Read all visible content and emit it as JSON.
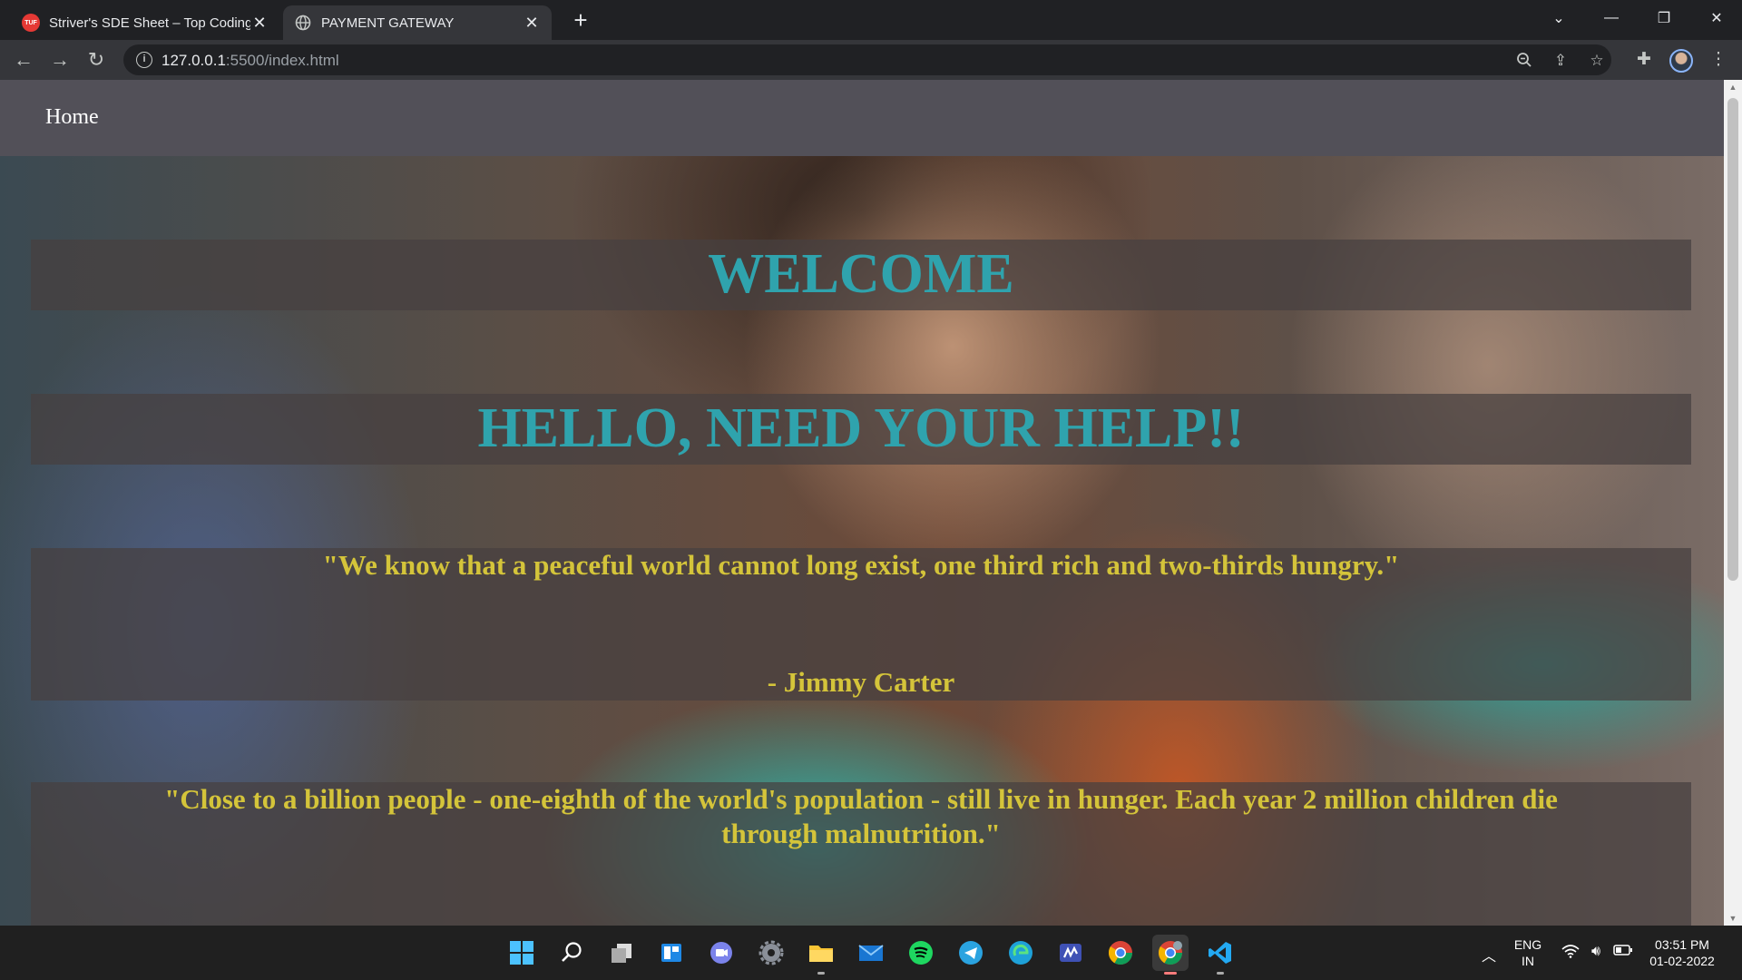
{
  "browser": {
    "tabs": [
      {
        "title": "Striver's SDE Sheet – Top Coding",
        "favicon": "TUF",
        "favicon_color": "#e53935",
        "active": false
      },
      {
        "title": "PAYMENT GATEWAY",
        "favicon": "globe-icon",
        "active": true
      }
    ],
    "new_tab_symbol": "+",
    "url_host": "127.0.0.1",
    "url_path": ":5500/index.html"
  },
  "page": {
    "nav": {
      "home_label": "Home"
    },
    "welcome": "WELCOME",
    "hello": "HELLO, NEED YOUR HELP!!",
    "quote1": "\"We know that a peaceful world cannot long exist, one third rich and two-thirds hungry.\"",
    "quote1_author": "- Jimmy Carter",
    "quote2": "\"Close to a billion people - one-eighth of the world's population - still live in hunger. Each year 2 million children die through malnutrition.\"",
    "colors": {
      "heading": "#2fa3ad",
      "quote": "#d4c43a",
      "navbar": "#525058"
    }
  },
  "taskbar": {
    "apps": [
      "windows-start-icon",
      "search-icon",
      "task-view-icon",
      "widgets-icon",
      "teams-chat-icon",
      "settings-icon",
      "file-explorer-icon",
      "mail-icon",
      "spotify-icon",
      "telegram-icon",
      "edge-icon",
      "ms-whiteboard-icon",
      "chrome-icon",
      "chrome-profile-icon",
      "vscode-icon"
    ],
    "lang_top": "ENG",
    "lang_bottom": "IN",
    "time": "03:51 PM",
    "date": "01-02-2022"
  }
}
